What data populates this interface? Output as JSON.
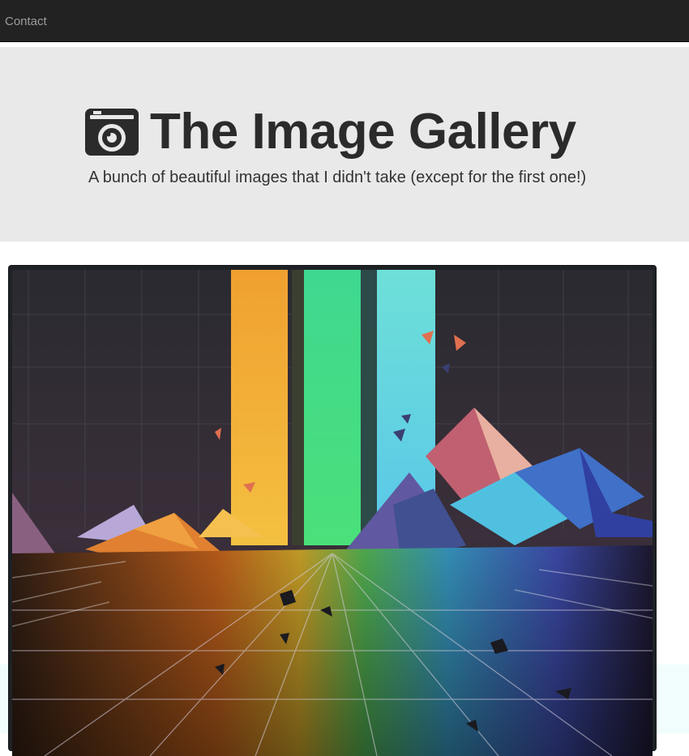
{
  "navbar": {
    "contact_label": "Contact"
  },
  "header": {
    "title": "The Image Gallery",
    "subtitle": "A bunch of beautiful images that I didn't take (except for the first one!)",
    "icon": "camera-icon"
  },
  "gallery": {
    "images": [
      {
        "icon": "abstract-rainbow-landscape-image"
      }
    ]
  },
  "colors": {
    "navbar_bg": "#222222",
    "nav_link": "#9d9d9d",
    "jumbotron_bg": "#e9e9e9",
    "title_text": "#2b2b2b",
    "thumbnail_border": "#1e2225"
  }
}
